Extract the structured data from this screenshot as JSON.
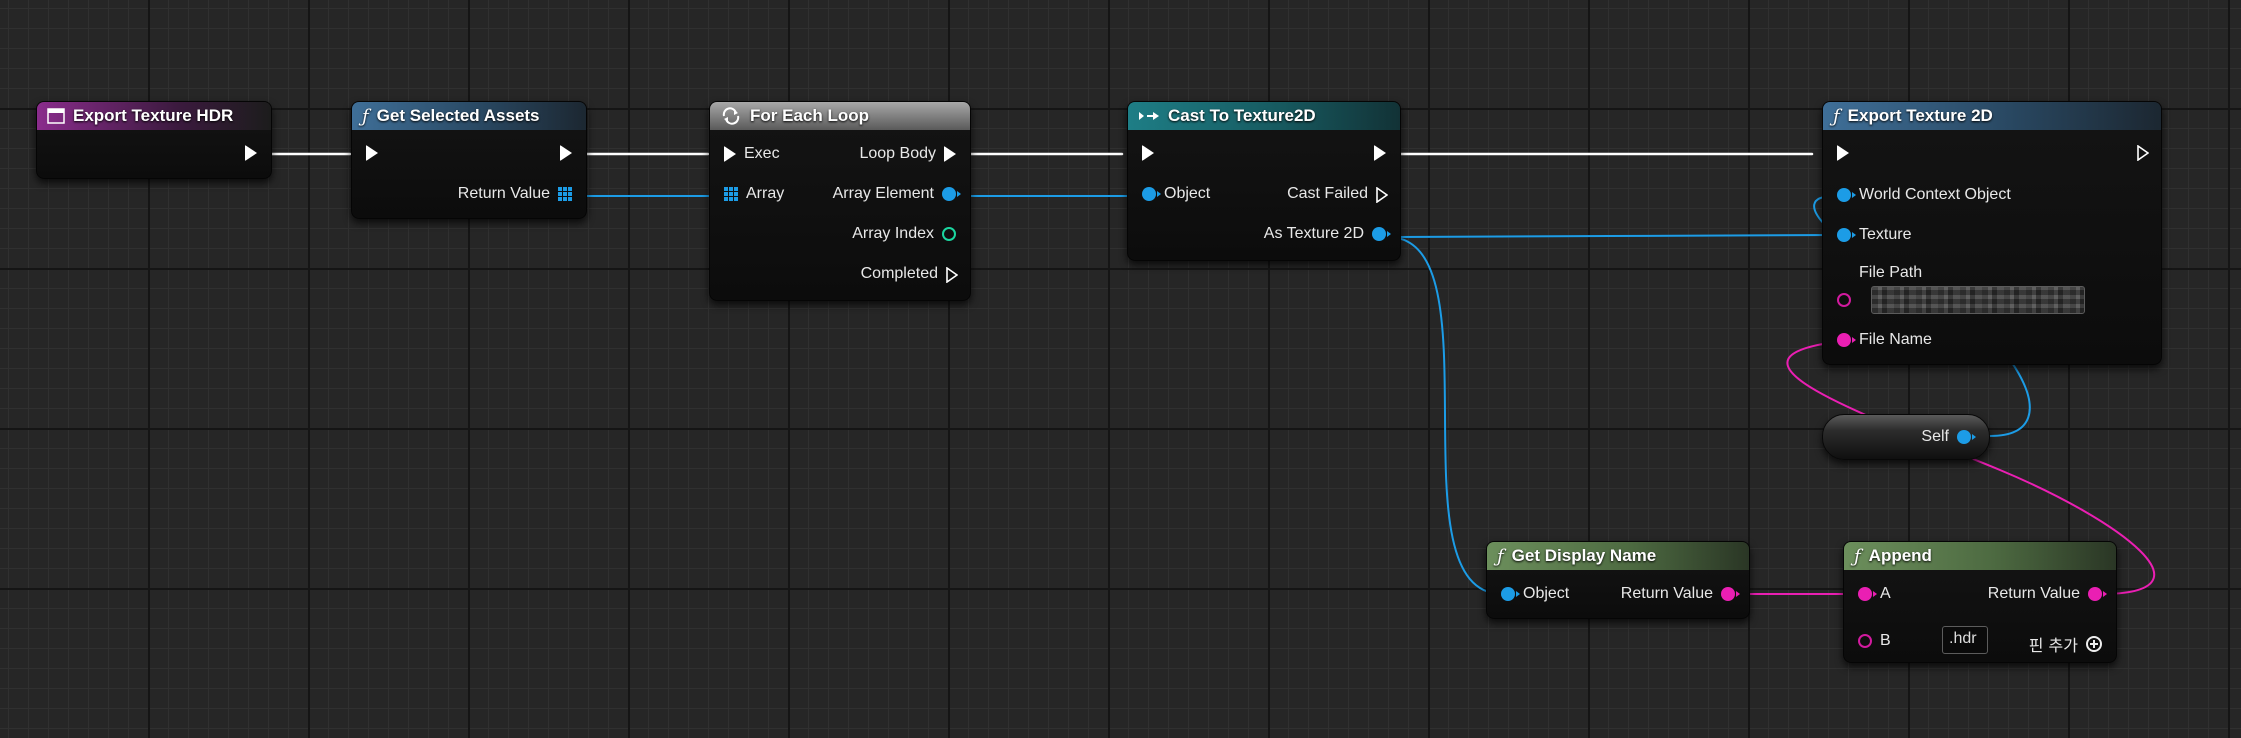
{
  "nodes": {
    "export_hdr": {
      "title": "Export Texture HDR"
    },
    "get_selected": {
      "title": "Get Selected Assets",
      "return_value": "Return Value"
    },
    "for_each": {
      "title": "For Each Loop",
      "exec": "Exec",
      "array": "Array",
      "loop_body": "Loop Body",
      "array_element": "Array Element",
      "array_index": "Array Index",
      "completed": "Completed"
    },
    "cast": {
      "title": "Cast To Texture2D",
      "object": "Object",
      "cast_failed": "Cast Failed",
      "as_texture": "As Texture 2D"
    },
    "export_2d": {
      "title": "Export Texture 2D",
      "world_context": "World Context Object",
      "texture": "Texture",
      "file_path": "File Path",
      "file_name": "File Name"
    },
    "self": {
      "label": "Self"
    },
    "get_display_name": {
      "title": "Get Display Name",
      "object": "Object",
      "return_value": "Return Value"
    },
    "append": {
      "title": "Append",
      "a": "A",
      "b": "B",
      "b_value": ".hdr",
      "return_value": "Return Value",
      "add_pin": "핀 추가"
    }
  },
  "colors": {
    "exec_wire": "#ffffff",
    "object_pin": "#1c9ce6",
    "string_pin": "#ea1fb3",
    "int_pin": "#1bd6a0",
    "event_header": "#8a2c8c",
    "function_header": "#3f6f98",
    "macro_header": "#a8a8a8",
    "cast_header": "#1e7e86",
    "pure_header": "#6c8f5c"
  },
  "icons": {
    "event": "event-icon",
    "function": "function-icon",
    "loop": "loop-icon",
    "cast": "cast-icon",
    "add": "add-pin-icon"
  }
}
